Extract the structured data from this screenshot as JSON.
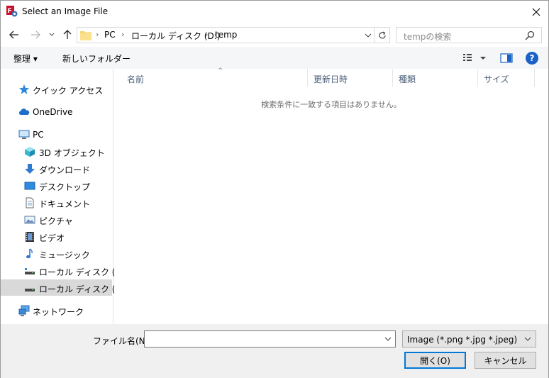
{
  "window": {
    "title": "Select an Image File"
  },
  "address": {
    "crumbs": [
      "PC",
      "ローカル ディスク (D:)",
      "temp"
    ]
  },
  "search": {
    "placeholder": "tempの検索"
  },
  "toolbar": {
    "organize_label": "整理 ▾",
    "new_folder_label": "新しいフォルダー",
    "help_label": "?"
  },
  "sidebar": {
    "items": [
      {
        "label": "クイック アクセス",
        "icon": "star-icon"
      },
      {
        "label": "OneDrive",
        "icon": "cloud-icon"
      },
      {
        "label": "PC",
        "icon": "computer-icon"
      },
      {
        "label": "3D オブジェクト",
        "icon": "cube-icon"
      },
      {
        "label": "ダウンロード",
        "icon": "download-arrow-icon"
      },
      {
        "label": "デスクトップ",
        "icon": "desktop-icon"
      },
      {
        "label": "ドキュメント",
        "icon": "document-icon"
      },
      {
        "label": "ピクチャ",
        "icon": "picture-icon"
      },
      {
        "label": "ビデオ",
        "icon": "film-icon"
      },
      {
        "label": "ミュージック",
        "icon": "music-note-icon"
      },
      {
        "label": "ローカル ディスク (C:)",
        "icon": "drive-icon"
      },
      {
        "label": "ローカル ディスク (D:)",
        "icon": "drive-icon"
      },
      {
        "label": "ネットワーク",
        "icon": "network-icon"
      }
    ],
    "selected_index": 11
  },
  "columns": [
    "名前",
    "更新日時",
    "種類",
    "サイズ"
  ],
  "empty_message": "検索条件に一致する項目はありません。",
  "footer": {
    "filename_label": "ファイル名(N):",
    "filename_value": "",
    "filetype_value": "Image (*.png *.jpg *.jpeg)",
    "open_label": "開く(O)",
    "cancel_label": "キャンセル"
  },
  "colors": {
    "accent": "#0078d7",
    "selected_bg": "#d9d9d9",
    "folder": "#f7d674"
  }
}
